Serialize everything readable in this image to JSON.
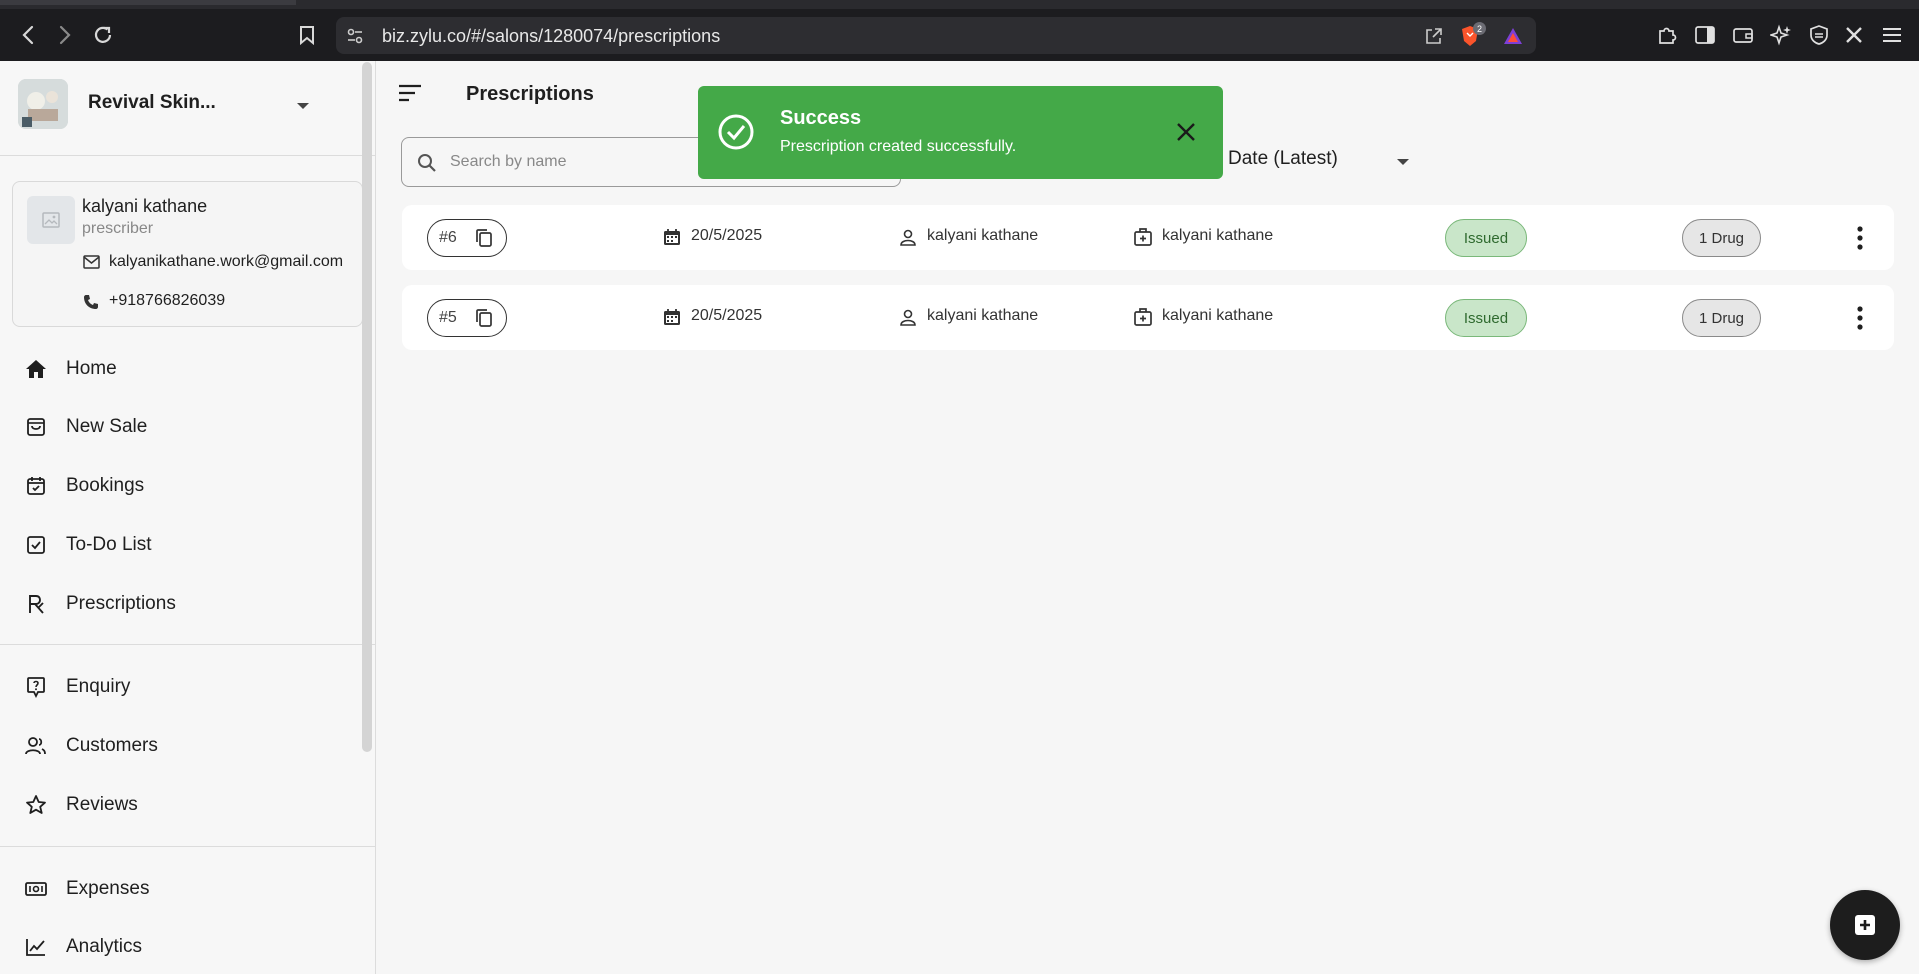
{
  "browser": {
    "url": "biz.zylu.co/#/salons/1280074/prescriptions",
    "extension_badge_count": "2"
  },
  "sidebar": {
    "org_name": "Revival Skin...",
    "profile": {
      "name": "kalyani kathane",
      "role": "prescriber",
      "email": "kalyanikathane.work@gmail.com",
      "phone": "+918766826039"
    },
    "nav_primary": [
      {
        "label": "Home",
        "icon": "home-icon"
      },
      {
        "label": "New Sale",
        "icon": "shopping-bag-icon"
      },
      {
        "label": "Bookings",
        "icon": "calendar-check-icon"
      },
      {
        "label": "To-Do List",
        "icon": "checkbox-icon"
      },
      {
        "label": "Prescriptions",
        "icon": "rx-icon"
      }
    ],
    "nav_secondary": [
      {
        "label": "Enquiry",
        "icon": "question-icon"
      },
      {
        "label": "Customers",
        "icon": "users-icon"
      },
      {
        "label": "Reviews",
        "icon": "star-icon"
      }
    ],
    "nav_tertiary": [
      {
        "label": "Expenses",
        "icon": "money-icon"
      },
      {
        "label": "Analytics",
        "icon": "chart-line-icon"
      }
    ]
  },
  "main": {
    "title": "Prescriptions",
    "search_placeholder": "Search by name",
    "sort_label": "Date (Latest)",
    "rows": [
      {
        "number": "#6",
        "date": "20/5/2025",
        "patient": "kalyani kathane",
        "prescriber": "kalyani kathane",
        "status": "Issued",
        "drugs": "1 Drug"
      },
      {
        "number": "#5",
        "date": "20/5/2025",
        "patient": "kalyani kathane",
        "prescriber": "kalyani kathane",
        "status": "Issued",
        "drugs": "1 Drug"
      }
    ]
  },
  "toast": {
    "title": "Success",
    "message": "Prescription created successfully.",
    "color": "#44a948"
  }
}
